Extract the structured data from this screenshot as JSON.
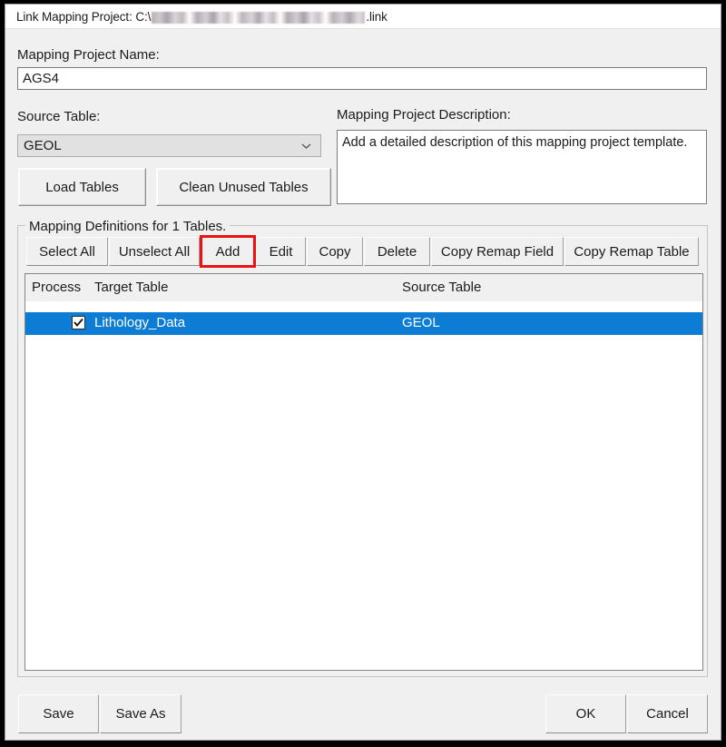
{
  "window": {
    "titlebar": {
      "prefix": "Link Mapping Project: C:\\",
      "path_redacted": true,
      "suffix": ".link"
    }
  },
  "form": {
    "project_name_label": "Mapping Project Name:",
    "project_name_value": "AGS4",
    "source_table_label": "Source Table:",
    "source_table_value": "GEOL",
    "source_table_options": [
      "GEOL"
    ],
    "load_tables_button": "Load Tables",
    "clean_unused_tables_button": "Clean Unused Tables",
    "description_label": "Mapping Project Description:",
    "description_value": "Add a detailed description of this mapping project template."
  },
  "mapping_group": {
    "title": "Mapping Definitions for 1 Tables.",
    "toolbar": [
      {
        "label": "Select All",
        "name": "select-all-button"
      },
      {
        "label": "Unselect All",
        "name": "unselect-all-button"
      },
      {
        "label": "Add",
        "name": "add-button",
        "highlighted": true
      },
      {
        "label": "Edit",
        "name": "edit-button"
      },
      {
        "label": "Copy",
        "name": "copy-button"
      },
      {
        "label": "Delete",
        "name": "delete-button"
      },
      {
        "label": "Copy Remap Field",
        "name": "copy-remap-field-button"
      },
      {
        "label": "Copy Remap Table",
        "name": "copy-remap-table-button"
      }
    ],
    "columns": [
      "Process",
      "Target Table",
      "Source Table"
    ],
    "rows": [
      {
        "process_checked": true,
        "target_table": "Lithology_Data",
        "source_table": "GEOL",
        "selected": true
      }
    ]
  },
  "footer": {
    "save_button": "Save",
    "save_as_button": "Save As",
    "ok_button": "OK",
    "cancel_button": "Cancel"
  },
  "colors": {
    "selection_blue": "#0c7cd5",
    "annotation_red": "#ee1111",
    "window_background": "#f0f0f0",
    "field_background": "#ffffff"
  }
}
